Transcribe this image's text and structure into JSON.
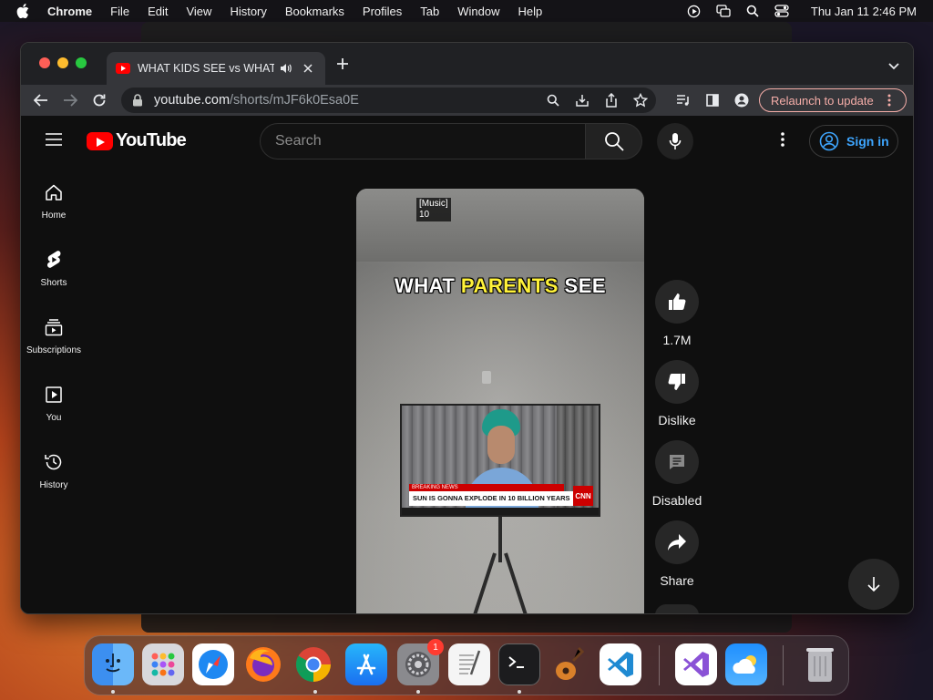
{
  "menubar": {
    "app_name": "Chrome",
    "items": [
      "File",
      "Edit",
      "View",
      "History",
      "Bookmarks",
      "Profiles",
      "Tab",
      "Window",
      "Help"
    ],
    "clock": "Thu Jan 11  2:46 PM"
  },
  "browser": {
    "tab_title": "WHAT KIDS SEE vs WHAT P",
    "url_host": "youtube.com",
    "url_path": "/shorts/mJF6k0Esa0E",
    "relaunch_label": "Relaunch to update"
  },
  "youtube": {
    "logo_text": "YouTube",
    "search_placeholder": "Search",
    "signin_label": "Sign in",
    "sidebar": [
      {
        "label": "Home"
      },
      {
        "label": "Shorts"
      },
      {
        "label": "Subscriptions"
      },
      {
        "label": "You"
      },
      {
        "label": "History"
      }
    ],
    "short": {
      "caption_line1": "[Music]",
      "caption_line2": "10",
      "overlay_pre": "WHAT ",
      "overlay_highlight": "PARENTS",
      "overlay_post": " SEE",
      "tv_banner": "BREAKING NEWS",
      "tv_headline": "SUN IS GONNA EXPLODE IN 10 BILLION YEARS",
      "tv_logo": "CNN"
    },
    "actions": {
      "like_count": "1.7M",
      "dislike_label": "Dislike",
      "comments_label": "Disabled",
      "share_label": "Share"
    }
  },
  "dock": {
    "settings_badge": "1"
  }
}
